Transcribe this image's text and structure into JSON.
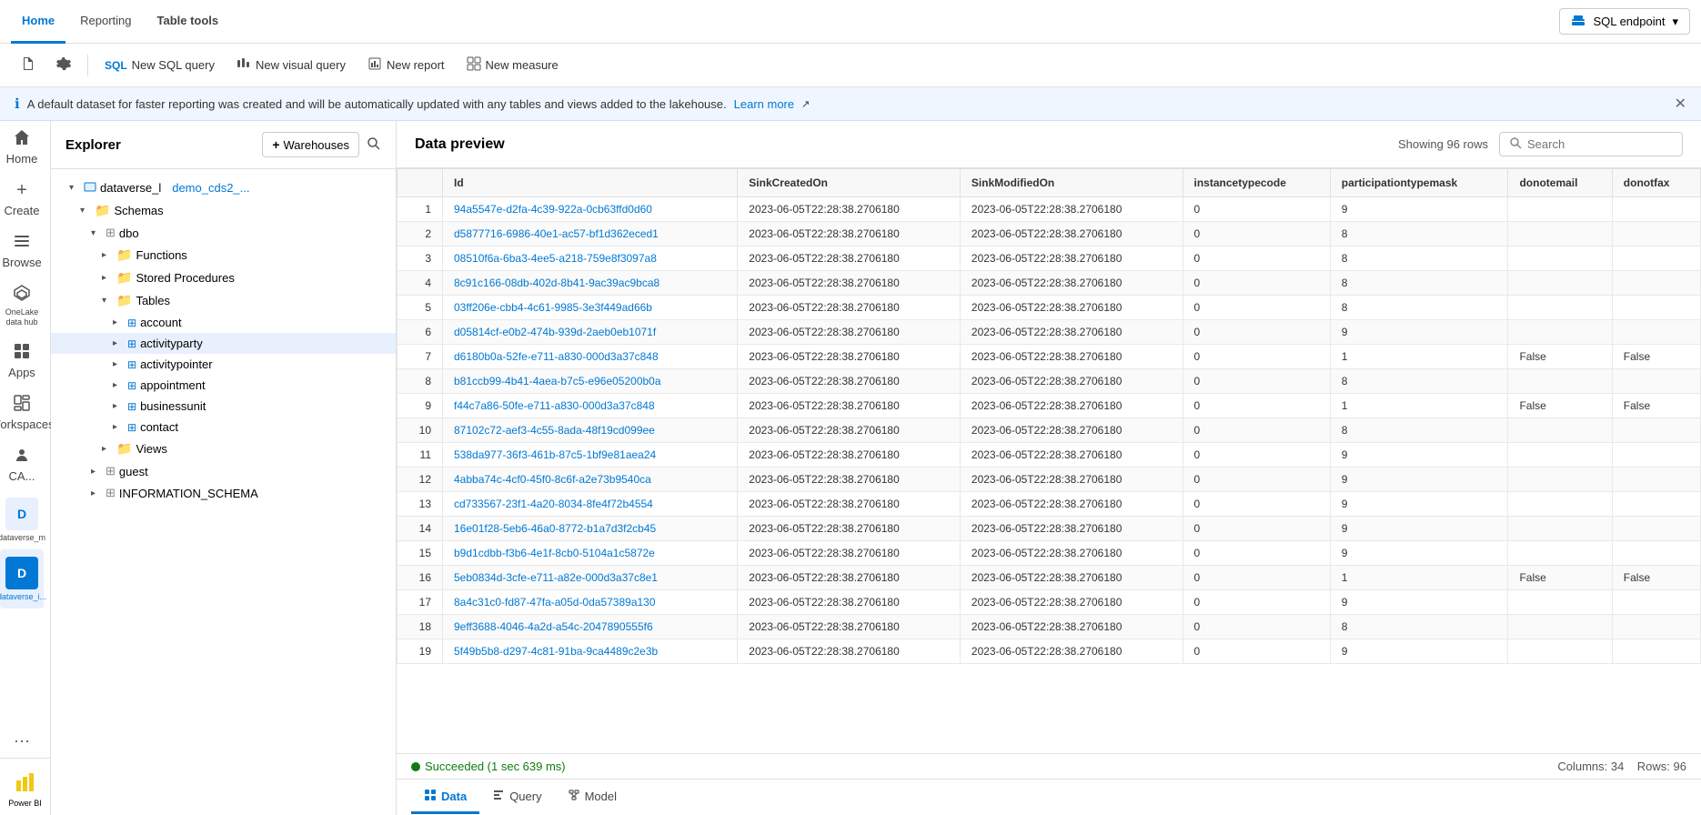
{
  "topNav": {
    "tabs": [
      {
        "id": "home",
        "label": "Home",
        "active": true
      },
      {
        "id": "reporting",
        "label": "Reporting",
        "active": false
      },
      {
        "id": "table-tools",
        "label": "Table tools",
        "active": false,
        "bold": true
      }
    ],
    "endpoint": {
      "icon": "warehouse-icon",
      "label": "SQL endpoint",
      "chevron": "▾"
    }
  },
  "toolbar": {
    "buttons": [
      {
        "id": "doc-icon",
        "label": "",
        "iconType": "doc"
      },
      {
        "id": "settings-icon",
        "label": "",
        "iconType": "gear"
      },
      {
        "id": "new-sql-query",
        "label": "New SQL query",
        "iconType": "sql"
      },
      {
        "id": "new-visual-query",
        "label": "New visual query",
        "iconType": "visual"
      },
      {
        "id": "new-report",
        "label": "New report",
        "iconType": "report"
      },
      {
        "id": "new-measure",
        "label": "New measure",
        "iconType": "measure"
      }
    ]
  },
  "infoBar": {
    "message": "A default dataset for faster reporting was created and will be automatically updated with any tables and views added to the lakehouse.",
    "linkText": "Learn more",
    "linkIcon": "↗"
  },
  "sidebarIcons": [
    {
      "id": "home",
      "icon": "🏠",
      "label": "Home"
    },
    {
      "id": "create",
      "icon": "+",
      "label": "Create",
      "isPlus": true
    },
    {
      "id": "browse",
      "icon": "☰",
      "label": "Browse"
    },
    {
      "id": "onelake",
      "icon": "◈",
      "label": "OneLake data hub"
    },
    {
      "id": "apps",
      "icon": "⊞",
      "label": "Apps"
    },
    {
      "id": "workspaces",
      "icon": "◫",
      "label": "Workspaces"
    },
    {
      "id": "ca",
      "icon": "👥",
      "label": "CA..."
    },
    {
      "id": "dataverse-m",
      "icon": "D",
      "label": "dataverse_m",
      "isBottom": false
    },
    {
      "id": "dataverse-i",
      "icon": "D",
      "label": "dataverse_i...",
      "isActive": true
    },
    {
      "id": "more",
      "icon": "···",
      "label": ""
    }
  ],
  "explorer": {
    "title": "Explorer",
    "addButtonLabel": "Warehouses",
    "tree": {
      "rootNode": {
        "label": "dataverse_l",
        "subLabel": "demo_cds2_...",
        "expanded": true
      },
      "schemas": {
        "label": "Schemas",
        "expanded": true,
        "dbo": {
          "label": "dbo",
          "expanded": true,
          "items": [
            {
              "id": "functions",
              "label": "Functions",
              "type": "folder",
              "expanded": false
            },
            {
              "id": "stored-procedures",
              "label": "Stored Procedures",
              "type": "folder",
              "expanded": false
            },
            {
              "id": "tables",
              "label": "Tables",
              "type": "folder",
              "expanded": true,
              "children": [
                {
                  "id": "account",
                  "label": "account",
                  "type": "table"
                },
                {
                  "id": "activityparty",
                  "label": "activityparty",
                  "type": "table",
                  "active": true
                },
                {
                  "id": "activitypointer",
                  "label": "activitypointer",
                  "type": "table"
                },
                {
                  "id": "appointment",
                  "label": "appointment",
                  "type": "table"
                },
                {
                  "id": "businessunit",
                  "label": "businessunit",
                  "type": "table"
                },
                {
                  "id": "contact",
                  "label": "contact",
                  "type": "table"
                }
              ]
            },
            {
              "id": "views",
              "label": "Views",
              "type": "folder",
              "expanded": false
            }
          ]
        },
        "guest": {
          "label": "guest",
          "type": "schema",
          "expanded": false
        },
        "information-schema": {
          "label": "INFORMATION_SCHEMA",
          "type": "schema",
          "expanded": false
        }
      }
    }
  },
  "dataPreview": {
    "title": "Data preview",
    "rowsCount": "Showing 96 rows",
    "searchPlaceholder": "Search",
    "columns": [
      "Id",
      "SinkCreatedOn",
      "SinkModifiedOn",
      "instancetypecode",
      "participationtypemask",
      "donotemail",
      "donotfax"
    ],
    "rows": [
      {
        "num": 1,
        "id": "94a5547e-d2fa-4c39-922a-0cb63ffd0d60",
        "sinkCreatedOn": "2023-06-05T22:28:38.2706180",
        "sinkModifiedOn": "2023-06-05T22:28:38.2706180",
        "instancetypecode": "0",
        "participationtypemask": "9",
        "donotemail": "",
        "donotfax": ""
      },
      {
        "num": 2,
        "id": "d5877716-6986-40e1-ac57-bf1d362eced1",
        "sinkCreatedOn": "2023-06-05T22:28:38.2706180",
        "sinkModifiedOn": "2023-06-05T22:28:38.2706180",
        "instancetypecode": "0",
        "participationtypemask": "8",
        "donotemail": "",
        "donotfax": ""
      },
      {
        "num": 3,
        "id": "08510f6a-6ba3-4ee5-a218-759e8f3097a8",
        "sinkCreatedOn": "2023-06-05T22:28:38.2706180",
        "sinkModifiedOn": "2023-06-05T22:28:38.2706180",
        "instancetypecode": "0",
        "participationtypemask": "8",
        "donotemail": "",
        "donotfax": ""
      },
      {
        "num": 4,
        "id": "8c91c166-08db-402d-8b41-9ac39ac9bca8",
        "sinkCreatedOn": "2023-06-05T22:28:38.2706180",
        "sinkModifiedOn": "2023-06-05T22:28:38.2706180",
        "instancetypecode": "0",
        "participationtypemask": "8",
        "donotemail": "",
        "donotfax": ""
      },
      {
        "num": 5,
        "id": "03ff206e-cbb4-4c61-9985-3e3f449ad66b",
        "sinkCreatedOn": "2023-06-05T22:28:38.2706180",
        "sinkModifiedOn": "2023-06-05T22:28:38.2706180",
        "instancetypecode": "0",
        "participationtypemask": "8",
        "donotemail": "",
        "donotfax": ""
      },
      {
        "num": 6,
        "id": "d05814cf-e0b2-474b-939d-2aeb0eb1071f",
        "sinkCreatedOn": "2023-06-05T22:28:38.2706180",
        "sinkModifiedOn": "2023-06-05T22:28:38.2706180",
        "instancetypecode": "0",
        "participationtypemask": "9",
        "donotemail": "",
        "donotfax": ""
      },
      {
        "num": 7,
        "id": "d6180b0a-52fe-e711-a830-000d3a37c848",
        "sinkCreatedOn": "2023-06-05T22:28:38.2706180",
        "sinkModifiedOn": "2023-06-05T22:28:38.2706180",
        "instancetypecode": "0",
        "participationtypemask": "1",
        "donotemail": "False",
        "donotfax": "False"
      },
      {
        "num": 8,
        "id": "b81ccb99-4b41-4aea-b7c5-e96e05200b0a",
        "sinkCreatedOn": "2023-06-05T22:28:38.2706180",
        "sinkModifiedOn": "2023-06-05T22:28:38.2706180",
        "instancetypecode": "0",
        "participationtypemask": "8",
        "donotemail": "",
        "donotfax": ""
      },
      {
        "num": 9,
        "id": "f44c7a86-50fe-e711-a830-000d3a37c848",
        "sinkCreatedOn": "2023-06-05T22:28:38.2706180",
        "sinkModifiedOn": "2023-06-05T22:28:38.2706180",
        "instancetypecode": "0",
        "participationtypemask": "1",
        "donotemail": "False",
        "donotfax": "False"
      },
      {
        "num": 10,
        "id": "87102c72-aef3-4c55-8ada-48f19cd099ee",
        "sinkCreatedOn": "2023-06-05T22:28:38.2706180",
        "sinkModifiedOn": "2023-06-05T22:28:38.2706180",
        "instancetypecode": "0",
        "participationtypemask": "8",
        "donotemail": "",
        "donotfax": ""
      },
      {
        "num": 11,
        "id": "538da977-36f3-461b-87c5-1bf9e81aea24",
        "sinkCreatedOn": "2023-06-05T22:28:38.2706180",
        "sinkModifiedOn": "2023-06-05T22:28:38.2706180",
        "instancetypecode": "0",
        "participationtypemask": "9",
        "donotemail": "",
        "donotfax": ""
      },
      {
        "num": 12,
        "id": "4abba74c-4cf0-45f0-8c6f-a2e73b9540ca",
        "sinkCreatedOn": "2023-06-05T22:28:38.2706180",
        "sinkModifiedOn": "2023-06-05T22:28:38.2706180",
        "instancetypecode": "0",
        "participationtypemask": "9",
        "donotemail": "",
        "donotfax": ""
      },
      {
        "num": 13,
        "id": "cd733567-23f1-4a20-8034-8fe4f72b4554",
        "sinkCreatedOn": "2023-06-05T22:28:38.2706180",
        "sinkModifiedOn": "2023-06-05T22:28:38.2706180",
        "instancetypecode": "0",
        "participationtypemask": "9",
        "donotemail": "",
        "donotfax": ""
      },
      {
        "num": 14,
        "id": "16e01f28-5eb6-46a0-8772-b1a7d3f2cb45",
        "sinkCreatedOn": "2023-06-05T22:28:38.2706180",
        "sinkModifiedOn": "2023-06-05T22:28:38.2706180",
        "instancetypecode": "0",
        "participationtypemask": "9",
        "donotemail": "",
        "donotfax": ""
      },
      {
        "num": 15,
        "id": "b9d1cdbb-f3b6-4e1f-8cb0-5104a1c5872e",
        "sinkCreatedOn": "2023-06-05T22:28:38.2706180",
        "sinkModifiedOn": "2023-06-05T22:28:38.2706180",
        "instancetypecode": "0",
        "participationtypemask": "9",
        "donotemail": "",
        "donotfax": ""
      },
      {
        "num": 16,
        "id": "5eb0834d-3cfe-e711-a82e-000d3a37c8e1",
        "sinkCreatedOn": "2023-06-05T22:28:38.2706180",
        "sinkModifiedOn": "2023-06-05T22:28:38.2706180",
        "instancetypecode": "0",
        "participationtypemask": "1",
        "donotemail": "False",
        "donotfax": "False"
      },
      {
        "num": 17,
        "id": "8a4c31c0-fd87-47fa-a05d-0da57389a130",
        "sinkCreatedOn": "2023-06-05T22:28:38.2706180",
        "sinkModifiedOn": "2023-06-05T22:28:38.2706180",
        "instancetypecode": "0",
        "participationtypemask": "9",
        "donotemail": "",
        "donotfax": ""
      },
      {
        "num": 18,
        "id": "9eff3688-4046-4a2d-a54c-2047890555f6",
        "sinkCreatedOn": "2023-06-05T22:28:38.2706180",
        "sinkModifiedOn": "2023-06-05T22:28:38.2706180",
        "instancetypecode": "0",
        "participationtypemask": "8",
        "donotemail": "",
        "donotfax": ""
      },
      {
        "num": 19,
        "id": "5f49b5b8-d297-4c81-91ba-9ca4489c2e3b",
        "sinkCreatedOn": "2023-06-05T22:28:38.2706180",
        "sinkModifiedOn": "2023-06-05T22:28:38.2706180",
        "instancetypecode": "0",
        "participationtypemask": "9",
        "donotemail": "",
        "donotfax": ""
      }
    ],
    "statusMessage": "Succeeded (1 sec 639 ms)",
    "columnsCount": "Columns: 34",
    "rowsTotal": "Rows: 96"
  },
  "bottomTabs": [
    {
      "id": "data",
      "label": "Data",
      "active": true
    },
    {
      "id": "query",
      "label": "Query",
      "active": false
    },
    {
      "id": "model",
      "label": "Model",
      "active": false
    }
  ],
  "powerbiBadge": "Power BI"
}
